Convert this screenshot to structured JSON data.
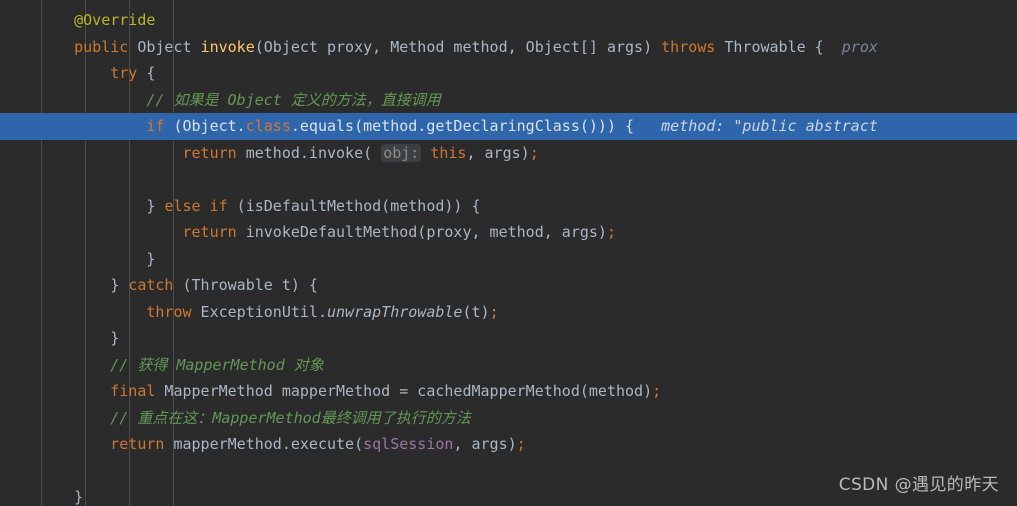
{
  "editor": {
    "theme_background": "#2b2b2b",
    "default_text_color": "#a9b7c6",
    "highlight_color": "#2f65ab",
    "comment_color": "#629755",
    "keyword_color": "#cc7832",
    "annotation_color": "#bbb529",
    "field_color": "#9876aa",
    "method_color": "#ffc66d"
  },
  "code": {
    "lines": [
      {
        "indent": 1,
        "tokens": [
          {
            "t": "@Override",
            "c": "anno"
          }
        ]
      },
      {
        "indent": 1,
        "tokens": [
          {
            "t": "public",
            "c": "kw"
          },
          {
            "t": " ",
            "c": "txt"
          },
          {
            "t": "Object",
            "c": "txt"
          },
          {
            "t": " ",
            "c": "txt"
          },
          {
            "t": "invoke",
            "c": "mth"
          },
          {
            "t": "(Object proxy, Method method, Object[] args) ",
            "c": "txt"
          },
          {
            "t": "throws",
            "c": "kw"
          },
          {
            "t": " Throwable { ",
            "c": "txt"
          },
          {
            "t": " prox",
            "c": "hint"
          }
        ]
      },
      {
        "indent": 2,
        "tokens": [
          {
            "t": "try",
            "c": "kw"
          },
          {
            "t": " {",
            "c": "txt"
          }
        ]
      },
      {
        "indent": 3,
        "tokens": [
          {
            "t": "// 如果是 Object 定义的方法，直接调用",
            "c": "cmt"
          }
        ]
      },
      {
        "indent": 3,
        "highlight": true,
        "tokens": [
          {
            "t": "if",
            "c": "kw"
          },
          {
            "t": " (Object.",
            "c": "txt"
          },
          {
            "t": "class",
            "c": "kw"
          },
          {
            "t": ".equals(method.getDeclaringClass())) {",
            "c": "txt"
          },
          {
            "t": "   method: ",
            "c": "hint"
          },
          {
            "t": "\"public abstract",
            "c": "hint"
          }
        ]
      },
      {
        "indent": 4,
        "tokens": [
          {
            "t": "return",
            "c": "kw"
          },
          {
            "t": " method.invoke( ",
            "c": "txt"
          },
          {
            "t": "obj:",
            "c": "phint"
          },
          {
            "t": " ",
            "c": "txt"
          },
          {
            "t": "this",
            "c": "kw"
          },
          {
            "t": ", args)",
            "c": "txt"
          },
          {
            "t": ";",
            "c": "semi"
          }
        ]
      },
      {
        "indent": 0,
        "tokens": []
      },
      {
        "indent": 3,
        "tokens": [
          {
            "t": "} ",
            "c": "txt"
          },
          {
            "t": "else if",
            "c": "kw"
          },
          {
            "t": " (isDefaultMethod(method)) {",
            "c": "txt"
          }
        ]
      },
      {
        "indent": 4,
        "tokens": [
          {
            "t": "return",
            "c": "kw"
          },
          {
            "t": " invokeDefaultMethod(proxy, method, args)",
            "c": "txt"
          },
          {
            "t": ";",
            "c": "semi"
          }
        ]
      },
      {
        "indent": 3,
        "tokens": [
          {
            "t": "}",
            "c": "txt"
          }
        ]
      },
      {
        "indent": 2,
        "tokens": [
          {
            "t": "} ",
            "c": "txt"
          },
          {
            "t": "catch",
            "c": "kw"
          },
          {
            "t": " (Throwable t) {",
            "c": "txt"
          }
        ]
      },
      {
        "indent": 3,
        "tokens": [
          {
            "t": "throw",
            "c": "kw"
          },
          {
            "t": " ExceptionUtil.",
            "c": "txt"
          },
          {
            "t": "unwrapThrowable",
            "c": "mthi"
          },
          {
            "t": "(t)",
            "c": "txt"
          },
          {
            "t": ";",
            "c": "semi"
          }
        ]
      },
      {
        "indent": 2,
        "tokens": [
          {
            "t": "}",
            "c": "txt"
          }
        ]
      },
      {
        "indent": 2,
        "tokens": [
          {
            "t": "// 获得 MapperMethod 对象",
            "c": "cmt"
          }
        ]
      },
      {
        "indent": 2,
        "tokens": [
          {
            "t": "final",
            "c": "kw"
          },
          {
            "t": " MapperMethod mapperMethod = cachedMapperMethod(method)",
            "c": "txt"
          },
          {
            "t": ";",
            "c": "semi"
          }
        ]
      },
      {
        "indent": 2,
        "tokens": [
          {
            "t": "// 重点在这：MapperMethod最终调用了执行的方法",
            "c": "cmt"
          }
        ]
      },
      {
        "indent": 2,
        "tokens": [
          {
            "t": "return",
            "c": "kw"
          },
          {
            "t": " mapperMethod.execute(",
            "c": "txt"
          },
          {
            "t": "sqlSession",
            "c": "field"
          },
          {
            "t": ", args)",
            "c": "txt"
          },
          {
            "t": ";",
            "c": "semi"
          }
        ]
      },
      {
        "indent": 0,
        "tokens": []
      },
      {
        "indent": 1,
        "tokens": [
          {
            "t": "}",
            "c": "txt"
          }
        ]
      }
    ]
  },
  "watermark": {
    "text": "CSDN @遇见的昨天"
  }
}
